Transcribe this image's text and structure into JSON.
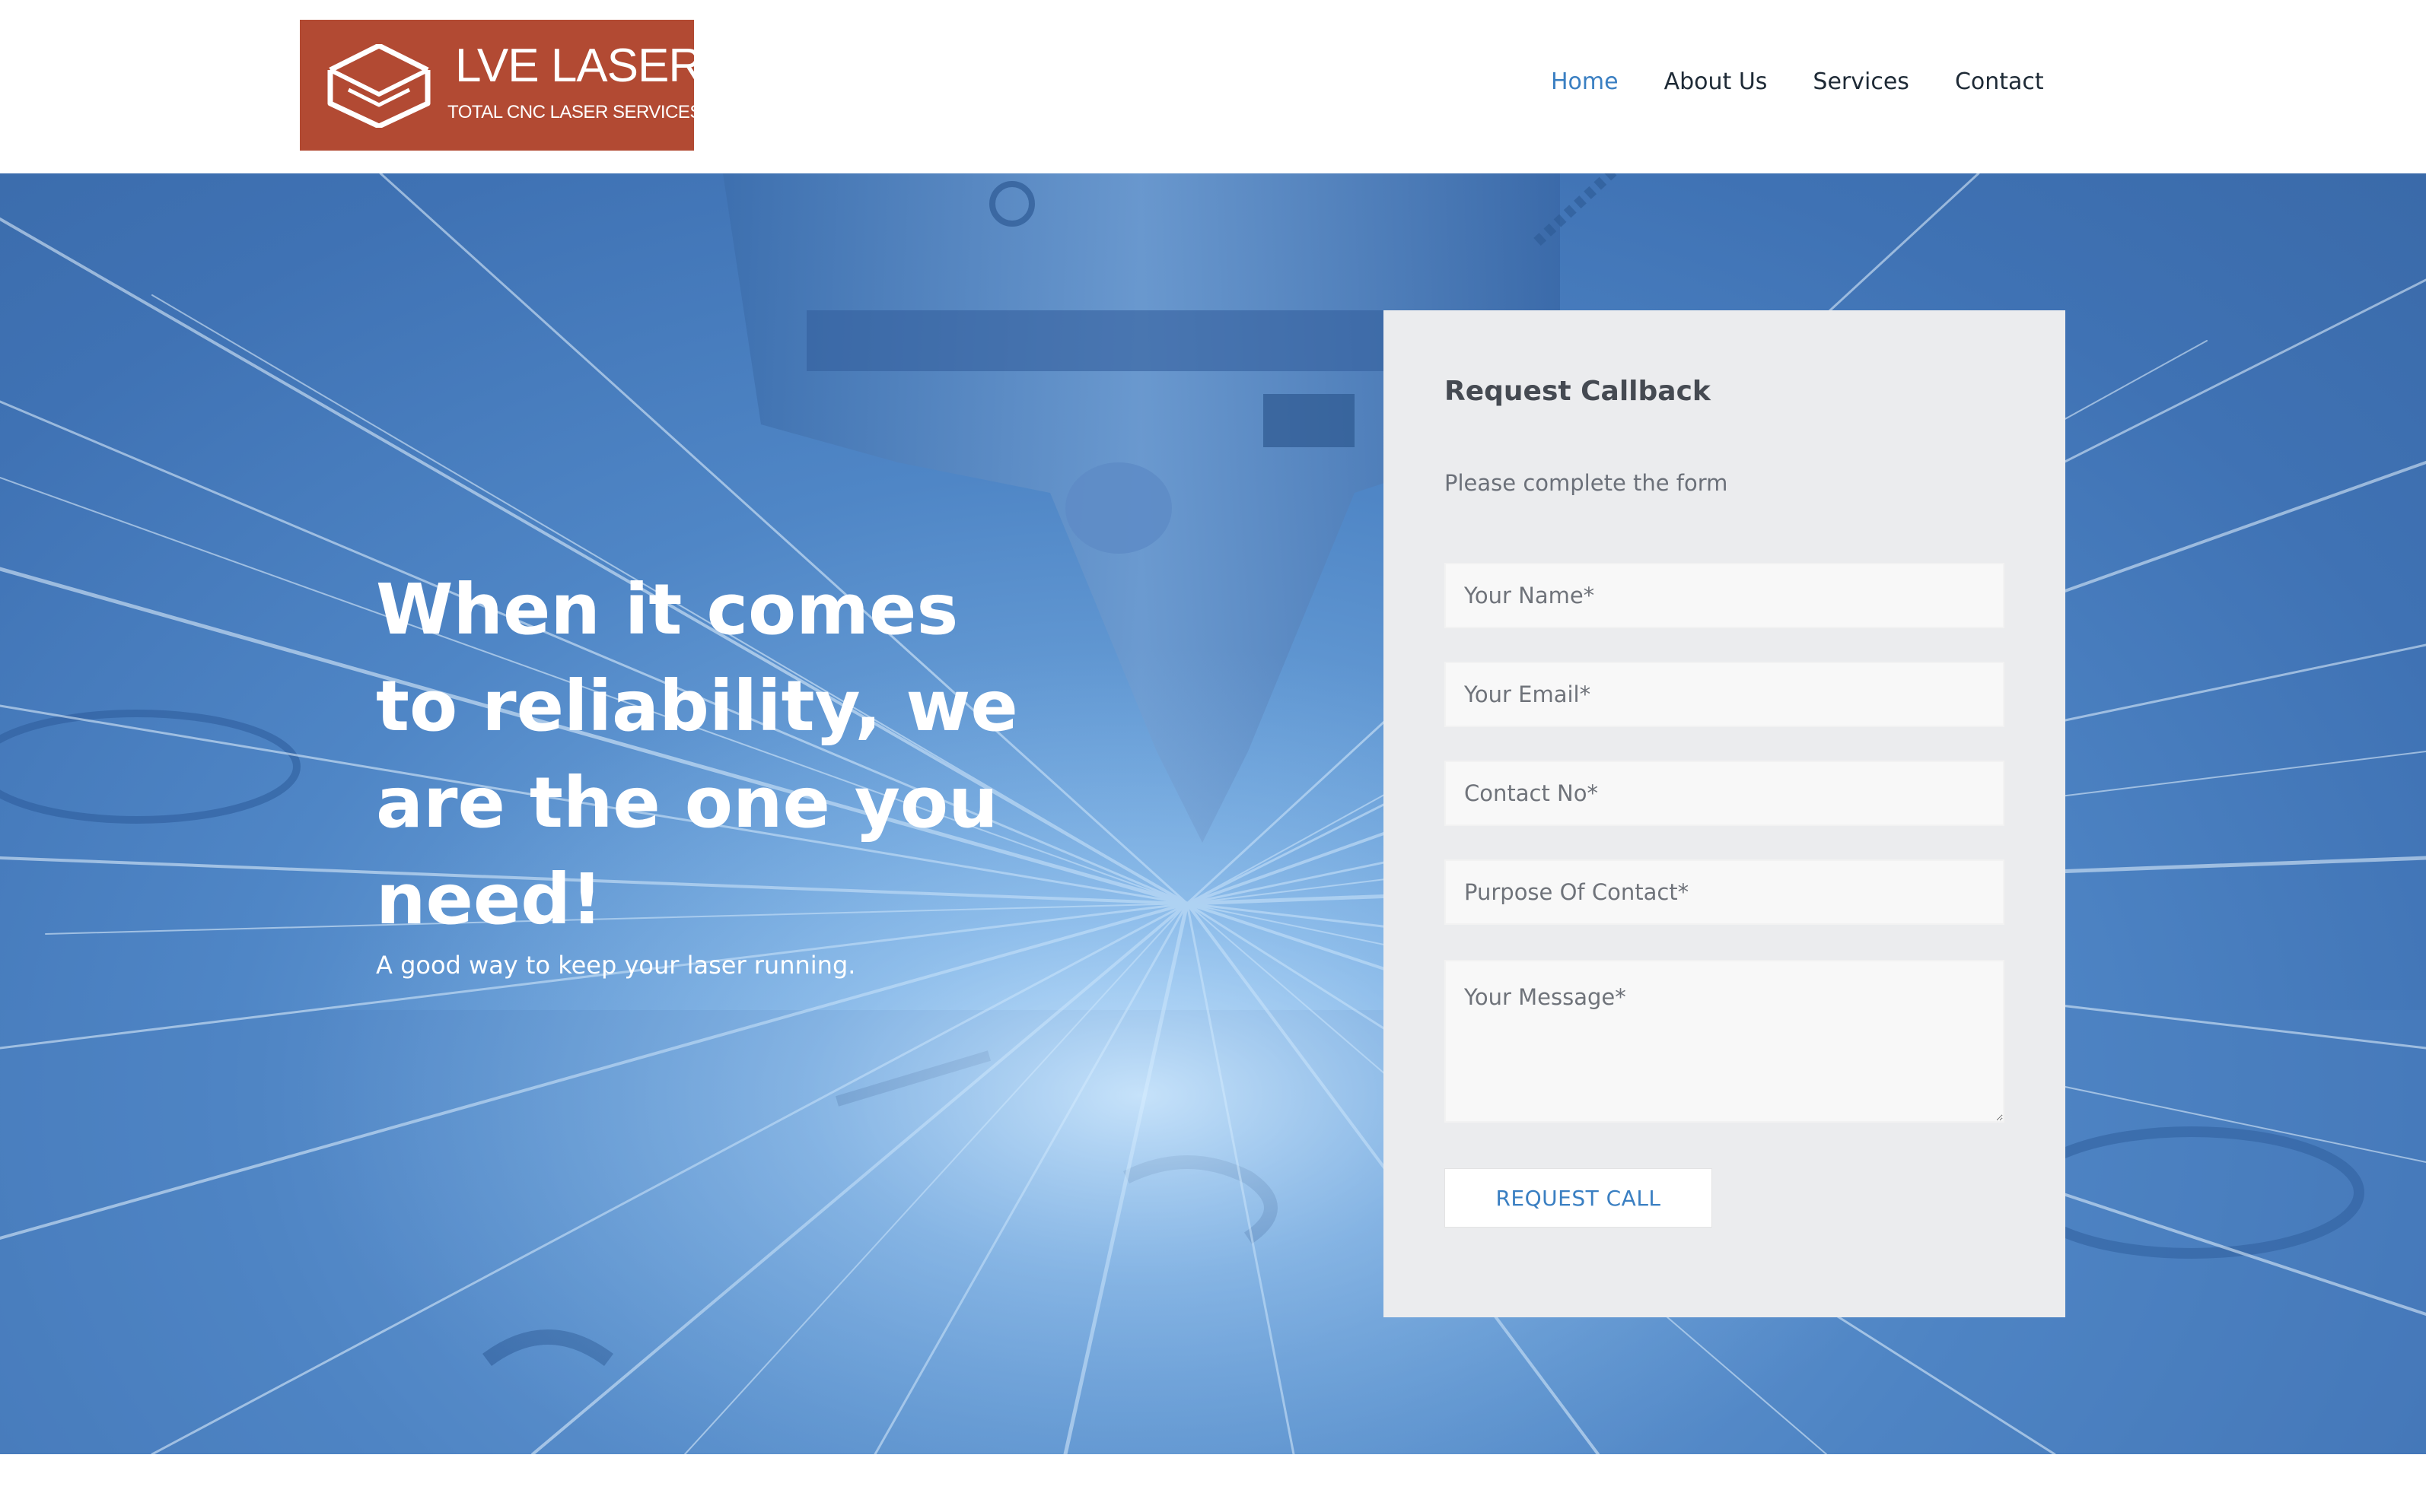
{
  "brand": {
    "name": "LVE LASER",
    "tagline": "TOTAL CNC LASER SERVICES",
    "logo_color": "#b24a33",
    "logo_icon": "envelope-chevron-icon"
  },
  "nav": {
    "items": [
      {
        "label": "Home",
        "active": true
      },
      {
        "label": "About Us",
        "active": false
      },
      {
        "label": "Services",
        "active": false
      },
      {
        "label": "Contact",
        "active": false
      }
    ],
    "active_color": "#3a7fc2"
  },
  "hero": {
    "heading": "When it comes to reliability, we are the one you need!",
    "subheading": "A good way to keep your laser running."
  },
  "form": {
    "title": "Request Callback",
    "subtitle": "Please complete the form",
    "fields": {
      "name": {
        "placeholder": "Your Name*",
        "value": ""
      },
      "email": {
        "placeholder": "Your Email*",
        "value": ""
      },
      "contact": {
        "placeholder": "Contact No*",
        "value": ""
      },
      "purpose": {
        "placeholder": "Purpose Of Contact*",
        "value": ""
      },
      "message": {
        "placeholder": "Your Message*",
        "value": ""
      }
    },
    "submit_label": "REQUEST CALL"
  }
}
